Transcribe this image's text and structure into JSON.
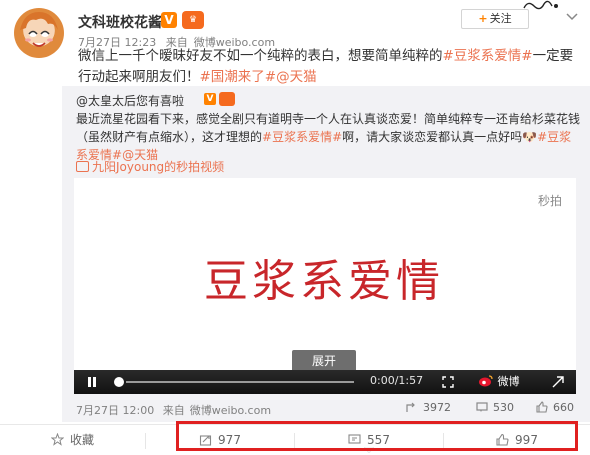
{
  "post": {
    "user_name": "文科班校花酱",
    "verified_badge": "V",
    "time": "7月27日 12:23",
    "source_prefix": "来自",
    "source": "微博weibo.com",
    "follow_label": "关注",
    "text_plain_1": "微信上一千个暧昧好友不如一个纯粹的表白，想要简单纯粹的",
    "hashtag_1": "#豆浆系爱情#",
    "text_plain_2": "一定要行动起来啊朋友们！",
    "hashtag_2": "#国潮来了#",
    "mention_1": "@天猫"
  },
  "repost": {
    "orig_user": "@太皇太后您有喜啦",
    "orig_text_1": "最近流星花园看下来，感觉全剧只有道明寺一个人在认真谈恋爱！简单纯粹专一还肯给杉菜花钱（虽然财产有点缩水），这才理想的",
    "orig_hashtag": "#豆浆系爱情#",
    "orig_text_2": "啊，请大家谈恋爱都认真一点好吗",
    "orig_hashtag_2": "#豆浆系爱情#",
    "orig_mention": "@天猫",
    "video_link": "九阳Joyoung的秒拍视频",
    "video": {
      "watermark": "秒拍",
      "title_art": "豆浆系爱情",
      "expand_label": "展开",
      "time": "0:00/1:57",
      "brand": "微博"
    },
    "orig_time": "7月27日 12:00",
    "orig_source_prefix": "来自",
    "orig_source": "微博weibo.com",
    "orig_stats": {
      "reposts": "3972",
      "comments": "530",
      "likes": "660"
    }
  },
  "bottom_bar": {
    "favorite": "收藏",
    "repost_count": "977",
    "comment_count": "557",
    "like_count": "997"
  },
  "colors": {
    "accent": "#ff8200",
    "link": "#eb7350",
    "highlight": "#e02020"
  }
}
